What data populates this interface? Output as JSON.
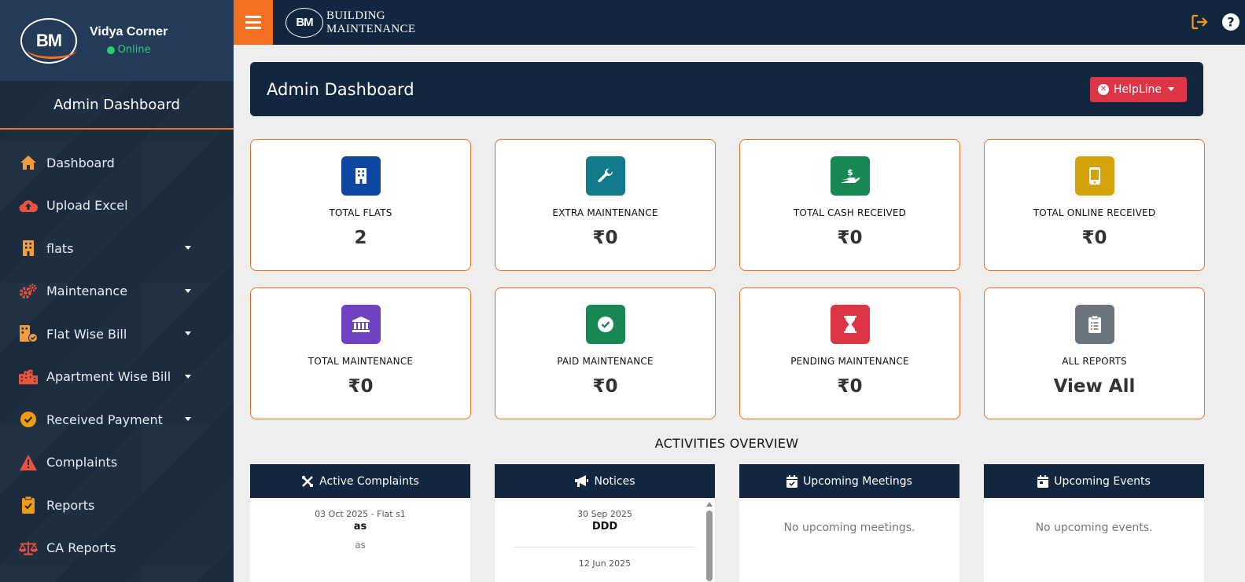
{
  "app": {
    "logo_text": "BM",
    "brand_line1": "BUILDING",
    "brand_line2": "MAINTENANCE"
  },
  "user": {
    "name": "Vidya Corner",
    "status": "Online"
  },
  "sidebar": {
    "title": "Admin Dashboard",
    "items": [
      {
        "label": "Dashboard",
        "icon": "home-icon",
        "has_caret": false
      },
      {
        "label": "Upload Excel",
        "icon": "cloud-upload-icon",
        "has_caret": false
      },
      {
        "label": "flats",
        "icon": "building-icon",
        "has_caret": true
      },
      {
        "label": "Maintenance",
        "icon": "gears-icon",
        "has_caret": true
      },
      {
        "label": "Flat Wise Bill",
        "icon": "building-check-icon",
        "has_caret": true
      },
      {
        "label": "Apartment Wise Bill",
        "icon": "city-icon",
        "has_caret": true
      },
      {
        "label": "Received Payment",
        "icon": "check-circle-icon",
        "has_caret": true
      },
      {
        "label": "Complaints",
        "icon": "warning-icon",
        "has_caret": false
      },
      {
        "label": "Reports",
        "icon": "clipboard-icon",
        "has_caret": false
      },
      {
        "label": "CA Reports",
        "icon": "scale-icon",
        "has_caret": false
      }
    ]
  },
  "header": {
    "title": "Admin Dashboard",
    "helpline_label": "HelpLine"
  },
  "cards": [
    {
      "label": "TOTAL FLATS",
      "value": "2",
      "icon": "building-icon",
      "color": "#0d47a1"
    },
    {
      "label": "EXTRA MAINTENANCE",
      "value": "₹0",
      "icon": "wrench-icon",
      "color": "#117a8b"
    },
    {
      "label": "TOTAL CASH RECEIVED",
      "value": "₹0",
      "icon": "hand-dollar-icon",
      "color": "#198754"
    },
    {
      "label": "TOTAL ONLINE RECEIVED",
      "value": "₹0",
      "icon": "mobile-icon",
      "color": "#d4a20a"
    },
    {
      "label": "TOTAL MAINTENANCE",
      "value": "₹0",
      "icon": "bank-icon",
      "color": "#6f42c1"
    },
    {
      "label": "PAID MAINTENANCE",
      "value": "₹0",
      "icon": "check-circle-icon",
      "color": "#198754"
    },
    {
      "label": "PENDING MAINTENANCE",
      "value": "₹0",
      "icon": "hourglass-icon",
      "color": "#dc3545"
    },
    {
      "label": "ALL REPORTS",
      "value": "View All",
      "icon": "clipboard-list-icon",
      "color": "#6c757d"
    }
  ],
  "activities": {
    "title": "ACTIVITIES OVERVIEW",
    "complaints": {
      "title": "Active Complaints",
      "entry": {
        "date": "03 Oct 2025 - Flat s1",
        "title": "as",
        "desc": "as"
      }
    },
    "notices": {
      "title": "Notices",
      "entries": [
        {
          "date": "30 Sep 2025",
          "title": "DDD"
        },
        {
          "date": "12 Jun 2025"
        }
      ]
    },
    "meetings": {
      "title": "Upcoming Meetings",
      "empty": "No upcoming meetings."
    },
    "events": {
      "title": "Upcoming Events",
      "empty": "No upcoming events."
    }
  }
}
